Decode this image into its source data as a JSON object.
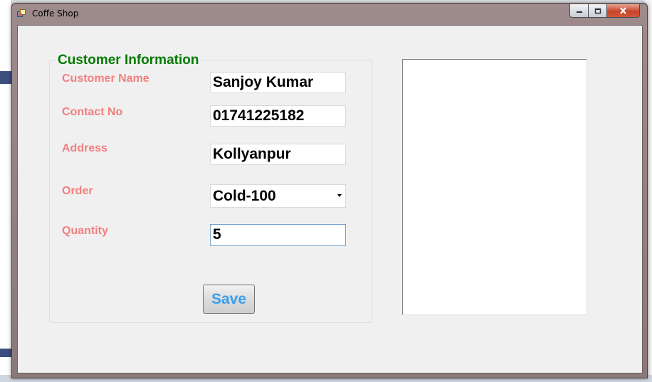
{
  "window": {
    "title": "Coffe Shop",
    "icon": "app-window-icon",
    "controls": [
      "minimize-icon",
      "maximize-icon",
      "close-icon"
    ]
  },
  "form": {
    "group_title": "Customer Information",
    "fields": [
      {
        "label": "Customer Name",
        "value": "Sanjoy Kumar"
      },
      {
        "label": "Contact No",
        "value": "01741225182"
      },
      {
        "label": "Address",
        "value": "Kollyanpur"
      },
      {
        "label": "Order",
        "value": "Cold-100"
      },
      {
        "label": "Quantity",
        "value": "5"
      }
    ],
    "save_label": "Save"
  },
  "colors": {
    "group_title": "#007a00",
    "field_label": "#f08080",
    "save_text": "#3aa0f0",
    "title_bar": "#9e8b8b"
  }
}
